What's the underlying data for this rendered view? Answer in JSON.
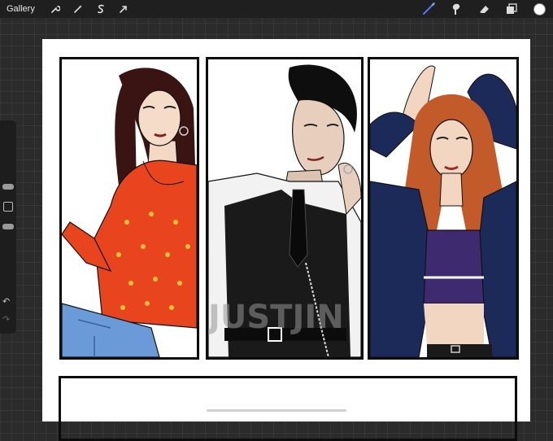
{
  "topbar": {
    "gallery_label": "Gallery",
    "left_tools": [
      "wrench-icon",
      "magic-wand-icon",
      "selection-icon",
      "transform-arrow-icon"
    ],
    "right_tools": [
      "brush-icon",
      "smudge-icon",
      "eraser-icon",
      "layers-icon",
      "color-icon"
    ],
    "active_tool": "brush-icon",
    "active_color": "#ffffff",
    "brush_accent": "#4a7cf0"
  },
  "sidebar": {
    "tools": [
      "brush-size-slider",
      "modify-button",
      "opacity-slider",
      "undo-icon",
      "redo-icon"
    ]
  },
  "artwork": {
    "watermark": "JUSTJIN",
    "panels": [
      {
        "subject": "woman-red-turtleneck",
        "shirt_color": "#e8441e",
        "hair_color": "#3a1412",
        "pants_color": "#6a9ad8"
      },
      {
        "subject": "man-black-vest",
        "vest_color": "#1a1a1a",
        "hair_color": "#0e0e0e"
      },
      {
        "subject": "woman-navy-jacket",
        "jacket_color": "#1c2a5a",
        "hair_color": "#c25a2a",
        "top_color": "#3e2a6e"
      }
    ]
  }
}
